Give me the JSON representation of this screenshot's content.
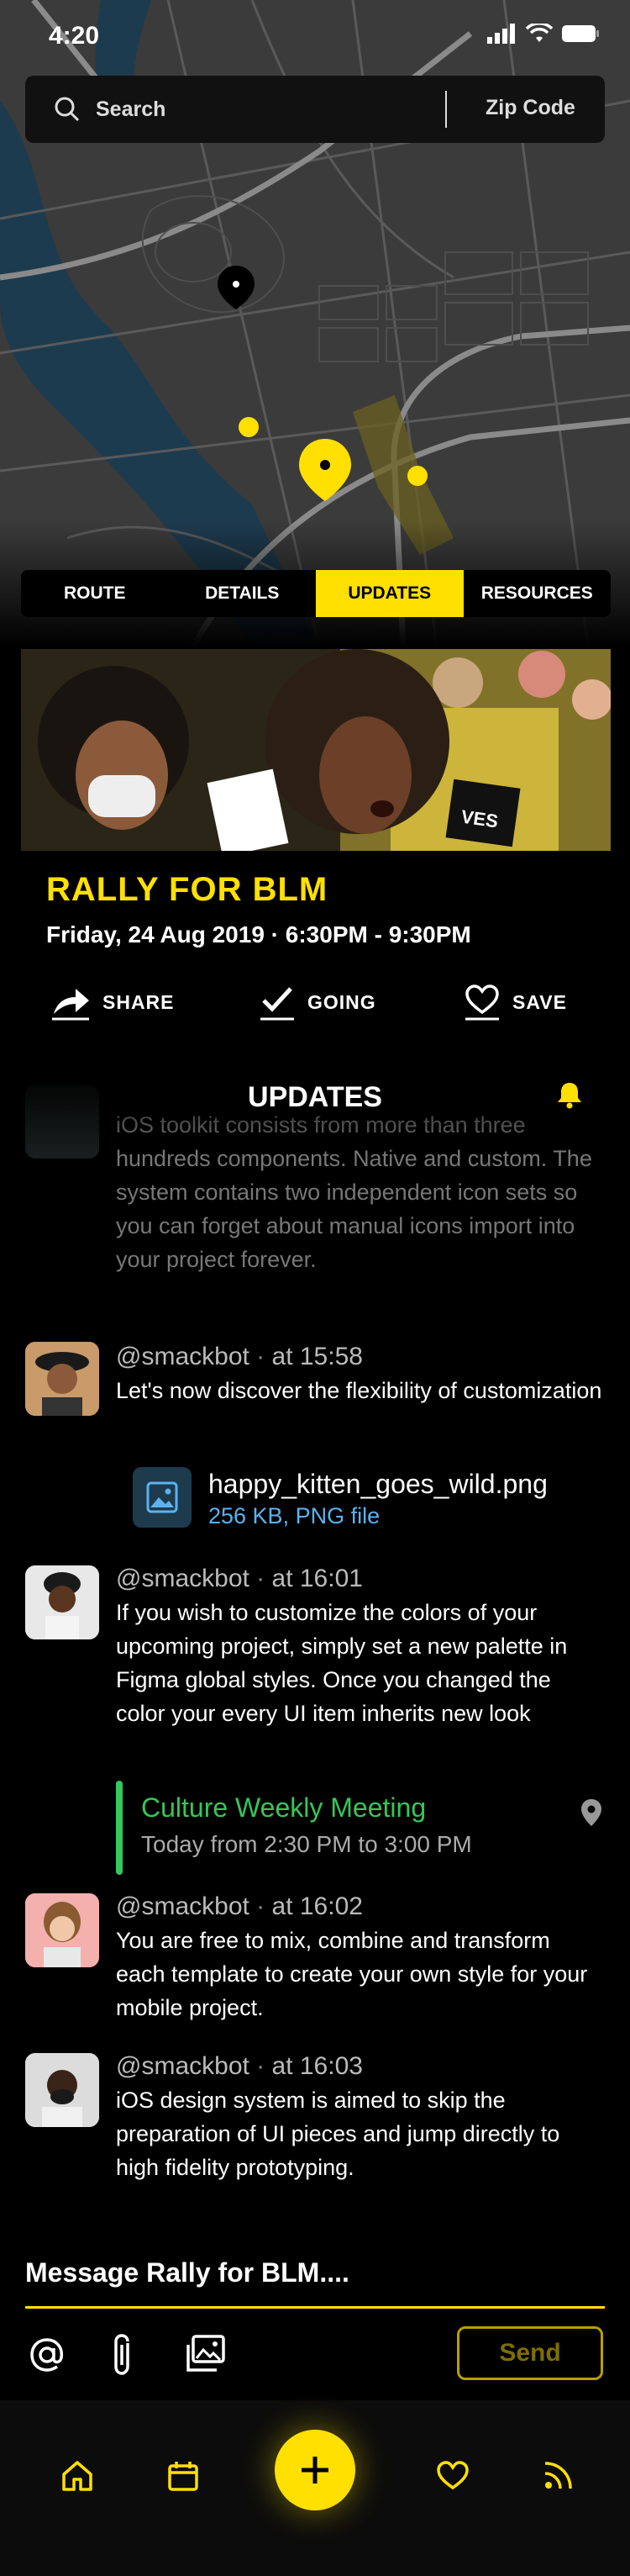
{
  "status_bar": {
    "time": "4:20"
  },
  "search": {
    "placeholder": "Search",
    "zip_label": "Zip Code"
  },
  "tabs": [
    {
      "label": "ROUTE",
      "active": false
    },
    {
      "label": "DETAILS",
      "active": false
    },
    {
      "label": "UPDATES",
      "active": true
    },
    {
      "label": "RESOURCES",
      "active": false
    }
  ],
  "event": {
    "title": "RALLY FOR BLM",
    "datetime": "Friday, 24 Aug 2019 · 6:30PM - 9:30PM",
    "photo_sign_text": "VES"
  },
  "actions": {
    "share": "SHARE",
    "going": "GOING",
    "save": "SAVE"
  },
  "updates": {
    "heading": "UPDATES",
    "faded_message": "iOS toolkit consists from more than three hundreds components. Native and custom. The system contains two independent icon sets so you can forget about manual icons import into your project forever.",
    "messages": [
      {
        "user": "@smackbot",
        "time": "at 15:58",
        "text": "Let's now discover the flexibility of customization"
      },
      {
        "user": "@smackbot",
        "time": "at 16:01",
        "text": "If you wish to customize the colors of your upcoming project, simply set a new palette in Figma global styles. Once you changed the color your every UI item inherits new look"
      },
      {
        "user": "@smackbot",
        "time": "at 16:02",
        "text": "You are free to mix, combine and transform each template to create your own style for your mobile project."
      },
      {
        "user": "@smackbot",
        "time": "at 16:03",
        "text": "iOS design system is aimed to skip the preparation of UI pieces and jump directly to high fidelity prototyping."
      }
    ],
    "attachment": {
      "name": "happy_kitten_goes_wild.png",
      "meta": "256 KB, PNG file"
    },
    "calendar_event": {
      "name": "Culture Weekly Meeting",
      "time": "Today from 2:30 PM to 3:00 PM"
    }
  },
  "composer": {
    "placeholder": "Message Rally for BLM....",
    "send_label": "Send"
  },
  "colors": {
    "accent": "#ffe000",
    "green": "#34c759",
    "link": "#5ab3f0"
  }
}
